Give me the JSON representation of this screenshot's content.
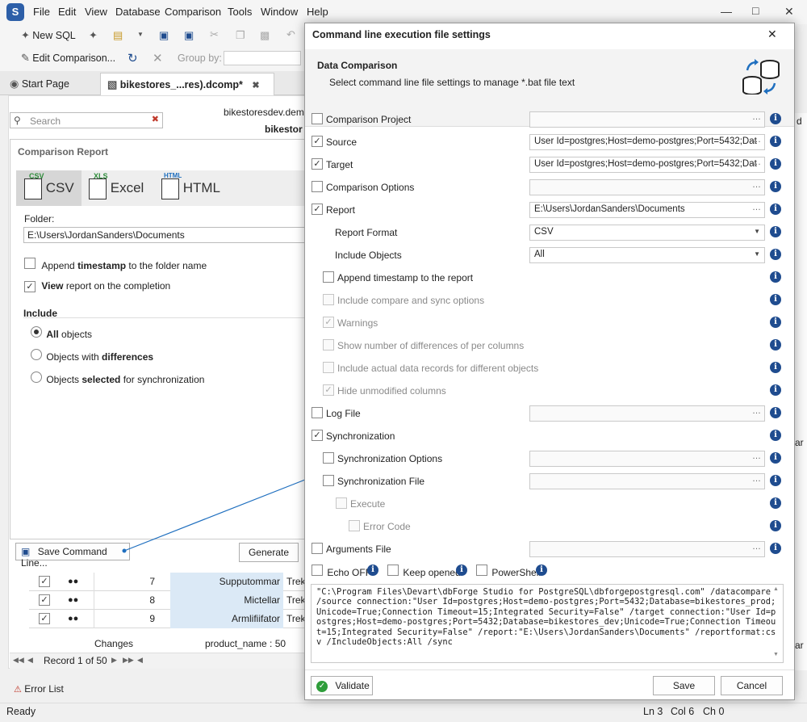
{
  "app": {
    "logo": "S",
    "menu": [
      "File",
      "Edit",
      "View",
      "Database",
      "Comparison",
      "Tools",
      "Window",
      "Help"
    ]
  },
  "toolbar": {
    "new_sql": "New SQL",
    "edit_comparison": "Edit Comparison...",
    "group_by": "Group by:"
  },
  "tabs": [
    {
      "label": "Start Page"
    },
    {
      "label": "bikestores_...res).dcomp*"
    }
  ],
  "left": {
    "search_placeholder": "Search",
    "conn_text": "bikestoresdev.demo-",
    "db_text": "bikestor",
    "report_title": "Comparison Report",
    "formats": [
      "CSV",
      "Excel",
      "HTML"
    ],
    "format_badges": [
      "CSV",
      "XLS",
      "HTML"
    ],
    "folder_label": "Folder:",
    "folder_value": "E:\\Users\\JordanSanders\\Documents",
    "append_pre": "Append ",
    "append_bold": "timestamp",
    "append_post": " to the folder name",
    "view_bold": "View",
    "view_post": " report on the completion",
    "include_label": "Include",
    "opt_all_bold": "All",
    "opt_all_post": " objects",
    "opt_diff_pre": "Objects with ",
    "opt_diff_bold": "differences",
    "opt_sel_pre": "Objects ",
    "opt_sel_bold": "selected",
    "opt_sel_post": " for synchronization",
    "save_cmd": "Save Command Line...",
    "generate": "Generate",
    "rows": [
      {
        "num": "7",
        "name": "Supputommar",
        "val": "Trek Slash"
      },
      {
        "num": "8",
        "name": "Mictellar",
        "val": "Trek Reme"
      },
      {
        "num": "9",
        "name": "Armlifiifator",
        "val": "Trek Conc"
      }
    ],
    "changes": "Changes",
    "product_name": "product_name : 50",
    "record": "Record 1 of 50",
    "error_list": "Error List",
    "right_edge_d": "d",
    "right_edge_ar": "ar"
  },
  "status": {
    "ready": "Ready",
    "ln": "Ln 3",
    "col": "Col 6",
    "ch": "Ch 0"
  },
  "dialog": {
    "title": "Command line execution file settings",
    "header_title": "Data Comparison",
    "header_sub": "Select command line file settings to manage *.bat file text",
    "rows": [
      {
        "label": "Comparison Project",
        "checked": false,
        "disabled": false,
        "field": "",
        "field_type": "browse"
      },
      {
        "label": "Source",
        "checked": true,
        "disabled": false,
        "field": "User Id=postgres;Host=demo-postgres;Port=5432;Dat",
        "field_type": "browse"
      },
      {
        "label": "Target",
        "checked": true,
        "disabled": false,
        "field": "User Id=postgres;Host=demo-postgres;Port=5432;Dat",
        "field_type": "browse"
      },
      {
        "label": "Comparison Options",
        "checked": false,
        "disabled": false,
        "field": "",
        "field_type": "browse"
      },
      {
        "label": "Report",
        "checked": true,
        "disabled": false,
        "field": "E:\\Users\\JordanSanders\\Documents",
        "field_type": "browse"
      },
      {
        "label": "Report Format",
        "checked": null,
        "disabled": false,
        "field": "CSV",
        "field_type": "select"
      },
      {
        "label": "Include Objects",
        "checked": null,
        "disabled": false,
        "field": "All",
        "field_type": "select"
      },
      {
        "label": "Append timestamp to the report",
        "checked": false,
        "disabled": false,
        "field": null,
        "field_type": "none"
      },
      {
        "label": "Include compare and sync options",
        "checked": false,
        "disabled": true,
        "field": null,
        "field_type": "none"
      },
      {
        "label": "Warnings",
        "checked": true,
        "disabled": true,
        "field": null,
        "field_type": "none"
      },
      {
        "label": "Show number of differences of per columns",
        "checked": false,
        "disabled": true,
        "field": null,
        "field_type": "none"
      },
      {
        "label": "Include actual data records for different objects",
        "checked": false,
        "disabled": true,
        "field": null,
        "field_type": "none"
      },
      {
        "label": "Hide unmodified columns",
        "checked": true,
        "disabled": true,
        "field": null,
        "field_type": "none"
      },
      {
        "label": "Log File",
        "checked": false,
        "disabled": false,
        "field": "",
        "field_type": "browse"
      },
      {
        "label": "Synchronization",
        "checked": true,
        "disabled": false,
        "field": null,
        "field_type": "none"
      },
      {
        "label": "Synchronization Options",
        "checked": false,
        "disabled": false,
        "field": "",
        "field_type": "browse"
      },
      {
        "label": "Synchronization File",
        "checked": false,
        "disabled": false,
        "field": "",
        "field_type": "browse"
      },
      {
        "label": "Execute",
        "checked": false,
        "disabled": true,
        "field": null,
        "field_type": "none"
      },
      {
        "label": "Error Code",
        "checked": false,
        "disabled": true,
        "field": null,
        "field_type": "none"
      },
      {
        "label": "Arguments File",
        "checked": false,
        "disabled": false,
        "field": "",
        "field_type": "browse"
      }
    ],
    "echo_off": "Echo OFF",
    "keep_opened": "Keep opened",
    "powershell": "PowerShell",
    "command_text": "\"C:\\Program Files\\Devart\\dbForge Studio for PostgreSQL\\dbforgepostgresql.com\" /datacompare /source connection:\"User Id=postgres;Host=demo-postgres;Port=5432;Database=bikestores_prod;Unicode=True;Connection Timeout=15;Integrated Security=False\" /target connection:\"User Id=postgres;Host=demo-postgres;Port=5432;Database=bikestores_dev;Unicode=True;Connection Timeout=15;Integrated Security=False\" /report:\"E:\\Users\\JordanSanders\\Documents\" /reportformat:csv /IncludeObjects:All /sync",
    "validate": "Validate",
    "save": "Save",
    "cancel": "Cancel"
  }
}
